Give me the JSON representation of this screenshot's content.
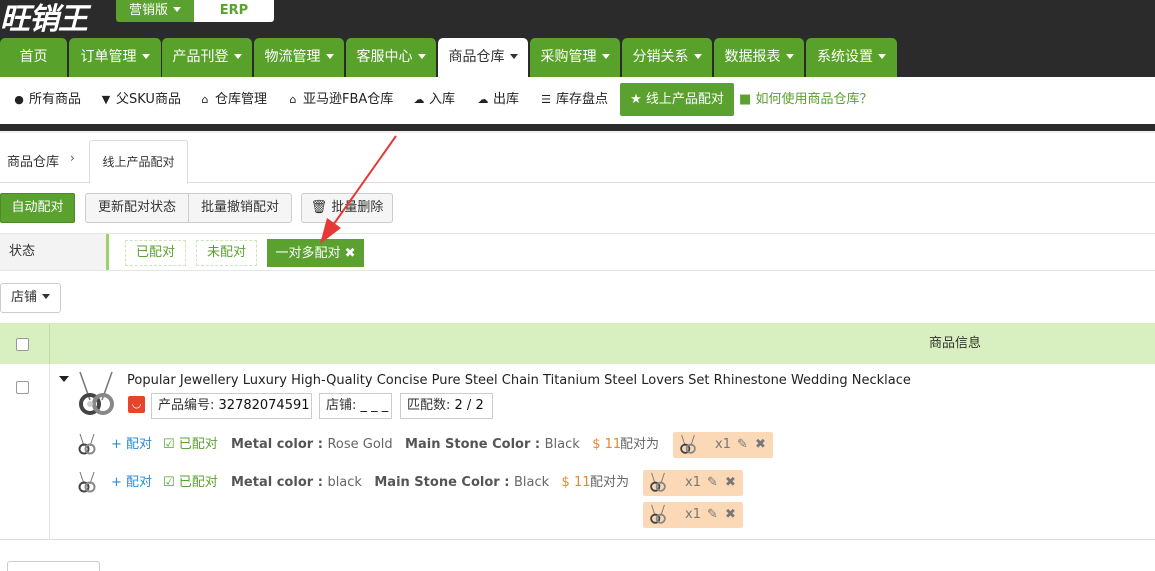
{
  "top": {
    "logo": "旺销王",
    "version_label": "营销版",
    "erp_label": "ERP"
  },
  "nav": {
    "tabs": [
      {
        "label": "首页",
        "caret": false
      },
      {
        "label": "订单管理",
        "caret": true
      },
      {
        "label": "产品刊登",
        "caret": true
      },
      {
        "label": "物流管理",
        "caret": true
      },
      {
        "label": "客服中心",
        "caret": true
      },
      {
        "label": "商品仓库",
        "caret": true,
        "active": true
      },
      {
        "label": "采购管理",
        "caret": true
      },
      {
        "label": "分销关系",
        "caret": true
      },
      {
        "label": "数据报表",
        "caret": true
      },
      {
        "label": "系统设置",
        "caret": true
      }
    ]
  },
  "subnav": {
    "items": [
      {
        "icon": "circle-icon",
        "label": "所有商品"
      },
      {
        "icon": "filter-icon",
        "label": "父SKU商品"
      },
      {
        "icon": "home-icon",
        "label": "仓库管理"
      },
      {
        "icon": "home-icon",
        "label": "亚马逊FBA仓库"
      },
      {
        "icon": "cloud-upload-icon",
        "label": "入库"
      },
      {
        "icon": "cloud-download-icon",
        "label": "出库"
      },
      {
        "icon": "list-icon",
        "label": "库存盘点"
      }
    ],
    "active_label": "线上产品配对",
    "help_label": "如何使用商品仓库？"
  },
  "breadcrumb": {
    "root": "商品仓库",
    "separator": "›",
    "current": "线上产品配对"
  },
  "toolbar": {
    "auto_match": "自动配对",
    "update_status": "更新配对状态",
    "batch_cancel": "批量撤销配对",
    "batch_delete": "批量删除"
  },
  "filter": {
    "status_label": "状态",
    "options": [
      "已配对",
      "未配对"
    ],
    "active_option": "一对多配对",
    "close_glyph": "✖"
  },
  "store_dropdown": "店铺",
  "table": {
    "header_title": "商品信息",
    "product": {
      "title": "Popular Jewellery Luxury High-Quality Concise Pure Steel Chain Titanium Steel Lovers Set Rhinestone Wedding Necklace",
      "product_no_label": "产品编号:",
      "product_no": "32782074591",
      "store_label": "店铺:",
      "store_value": "_ _ _",
      "match_count_label": "匹配数:",
      "match_count": "2 / 2",
      "platform_icon": "aliexpress-icon",
      "variants": [
        {
          "match_link": "+ 配对",
          "matched_label": "已配对",
          "attrs": [
            {
              "key": "Metal color",
              "value": "Rose Gold"
            },
            {
              "key": "Main Stone Color",
              "value": "Black"
            }
          ],
          "price": "$ 11",
          "matched_to_label": "配对为",
          "matches": [
            "x1"
          ]
        },
        {
          "match_link": "+ 配对",
          "matched_label": "已配对",
          "attrs": [
            {
              "key": "Metal color",
              "value": "black"
            },
            {
              "key": "Main Stone Color",
              "value": "Black"
            }
          ],
          "price": "$ 11",
          "matched_to_label": "配对为",
          "matches": [
            "x1",
            "x1"
          ]
        }
      ]
    }
  },
  "colors": {
    "brand_green": "#5aa12f",
    "topbar": "#2b2b2b",
    "annotation_arrow": "#e53935",
    "price_orange": "#e5892e",
    "match_tag_bg": "#fbd9b6"
  }
}
